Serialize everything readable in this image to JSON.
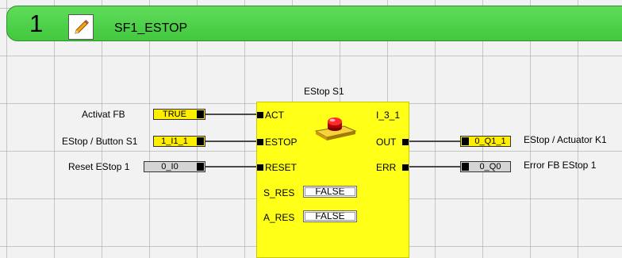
{
  "network": {
    "number": "1",
    "title": "SF1_ESTOP",
    "header_color": "#48cc44",
    "edit_icon": "pencil-icon"
  },
  "function_block": {
    "instance_name": "EStop S1",
    "type_name": "I_3_1",
    "icon": "emergency-stop-button-icon",
    "color": "#ffff18",
    "inputs": [
      "ACT",
      "ESTOP",
      "RESET"
    ],
    "outputs": [
      "OUT",
      "ERR"
    ],
    "internal_params": [
      {
        "name": "S_RES",
        "value": "FALSE"
      },
      {
        "name": "A_RES",
        "value": "FALSE"
      }
    ]
  },
  "input_connections": [
    {
      "label": "Activat FB",
      "value": "TRUE"
    },
    {
      "label": "EStop / Button S1",
      "value": "1_I1_1"
    },
    {
      "label": "Reset EStop 1",
      "value": "0_I0"
    }
  ],
  "output_connections": [
    {
      "label": "EStop / Actuator K1",
      "value": "0_Q1_1"
    },
    {
      "label": "Error FB EStop 1",
      "value": "0_Q0"
    }
  ]
}
